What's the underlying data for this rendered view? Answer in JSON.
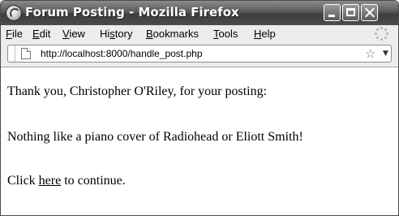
{
  "window": {
    "title": "Forum Posting - Mozilla Firefox",
    "app_icon": "firefox-icon"
  },
  "menubar": {
    "items": [
      {
        "mnemonic": "F",
        "rest": "ile"
      },
      {
        "mnemonic": "E",
        "rest": "dit"
      },
      {
        "mnemonic": "V",
        "rest": "iew"
      },
      {
        "pre": "Hi",
        "mnemonic": "s",
        "rest": "tory"
      },
      {
        "mnemonic": "B",
        "rest": "ookmarks"
      },
      {
        "mnemonic": "T",
        "rest": "ools"
      },
      {
        "mnemonic": "H",
        "rest": "elp"
      }
    ]
  },
  "navbar": {
    "url": "http://localhost:8000/handle_post.php",
    "bookmark_icon": "star-icon",
    "history_icon": "dropdown-arrow-icon"
  },
  "content": {
    "thanks_text": "Thank you, Christopher O'Riley, for your posting:",
    "post_body": "Nothing like a piano cover of Radiohead or Eliott Smith!",
    "continue_prefix": "Click ",
    "continue_link": "here",
    "continue_suffix": " to continue."
  },
  "colors": {
    "titlebar": "#4c4c4c",
    "chrome": "#ececec"
  }
}
